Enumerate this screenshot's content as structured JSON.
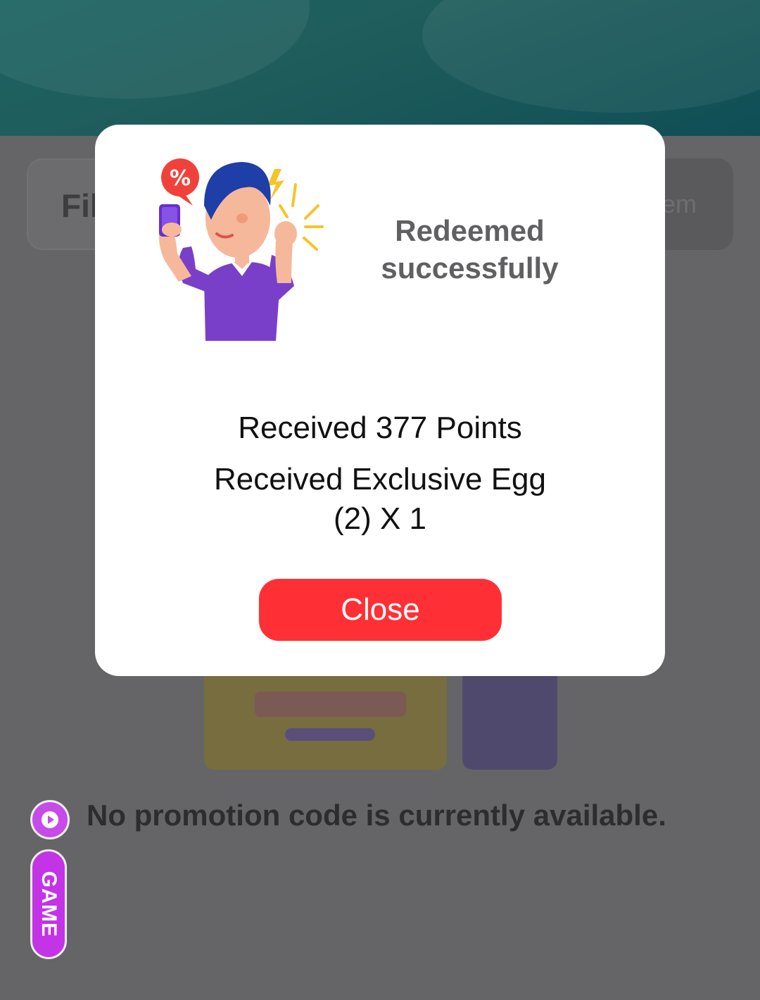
{
  "background": {
    "filter_tab_label": "Fil",
    "redeem_tab_label": "em",
    "empty_message": "No promotion code is currently available.",
    "game_button_label": "GAME",
    "play_icon": "play-icon"
  },
  "modal": {
    "title": "Redeemed successfully",
    "rewards": [
      "Received 377 Points",
      "Received Exclusive Egg (2) X 1"
    ],
    "close_label": "Close",
    "illustration": "celebrating-person-illustration",
    "accent_color": "#ff3035"
  }
}
